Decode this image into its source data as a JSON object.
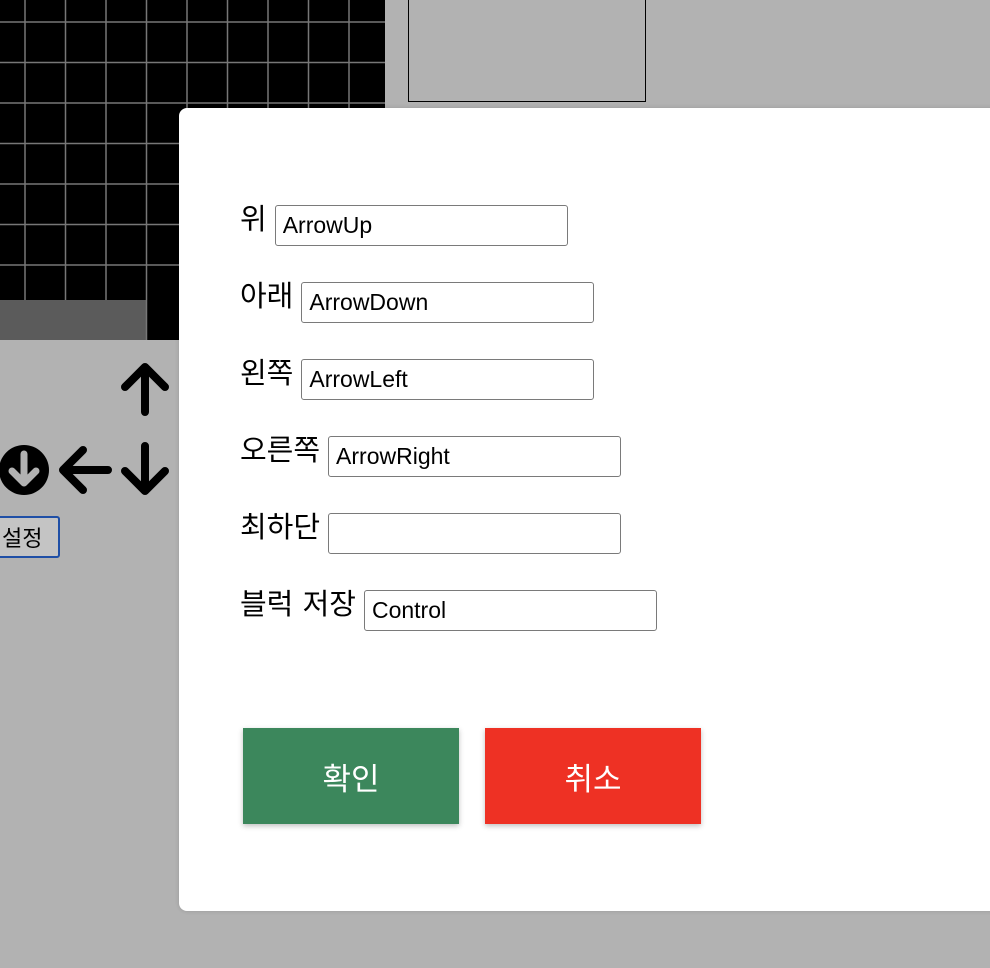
{
  "board": {
    "background_color": "#000000",
    "grid_color": "#777777",
    "bottom_row_fill": "#5b5b5b"
  },
  "controls": {
    "up_icon": "arrow-up-icon",
    "hard_drop_icon": "circle-arrow-down-icon",
    "left_icon": "arrow-left-icon",
    "down_icon": "arrow-down-icon",
    "settings_label": "설정"
  },
  "dialog": {
    "fields": [
      {
        "label": "위",
        "value": "ArrowUp"
      },
      {
        "label": "아래",
        "value": "ArrowDown"
      },
      {
        "label": "왼쪽",
        "value": "ArrowLeft"
      },
      {
        "label": "오른쪽",
        "value": "ArrowRight"
      },
      {
        "label": "최하단",
        "value": ""
      },
      {
        "label": "블럭 저장",
        "value": "Control"
      }
    ],
    "confirm_label": "확인",
    "cancel_label": "취소",
    "confirm_color": "#3c875c",
    "cancel_color": "#ee3124"
  }
}
